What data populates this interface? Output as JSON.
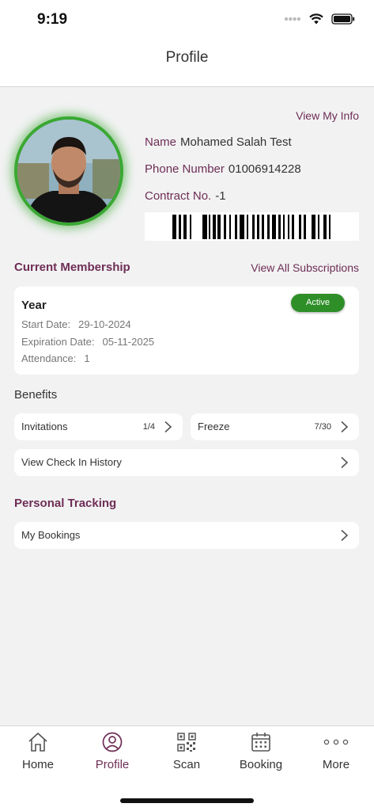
{
  "status_bar": {
    "time": "9:19"
  },
  "header": {
    "title": "Profile"
  },
  "profile": {
    "view_info_link": "View My Info",
    "name_label": "Name",
    "name_value": "Mohamed Salah Test",
    "phone_label": "Phone Number",
    "phone_value": "01006914228",
    "contract_label": "Contract No.",
    "contract_value": "-1"
  },
  "membership": {
    "section_title": "Current Membership",
    "view_all_link": "View All Subscriptions",
    "plan_name": "Year",
    "status": "Active",
    "start_label": "Start Date:",
    "start_value": "29-10-2024",
    "expiration_label": "Expiration Date:",
    "expiration_value": "05-11-2025",
    "attendance_label": "Attendance:",
    "attendance_value": "1"
  },
  "benefits": {
    "title": "Benefits",
    "invitations_label": "Invitations",
    "invitations_count": "1/4",
    "freeze_label": "Freeze",
    "freeze_count": "7/30",
    "history_label": "View Check In History"
  },
  "tracking": {
    "section_title": "Personal Tracking",
    "bookings_label": "My Bookings"
  },
  "tab_bar": {
    "items": [
      {
        "label": "Home",
        "icon": "home-icon"
      },
      {
        "label": "Profile",
        "icon": "user-circle-icon"
      },
      {
        "label": "Scan",
        "icon": "qr-code-icon"
      },
      {
        "label": "Booking",
        "icon": "calendar-icon"
      },
      {
        "label": "More",
        "icon": "more-dots-icon"
      }
    ],
    "active": "Profile"
  },
  "colors": {
    "accent": "#6e2e55",
    "active_badge": "#2e8f28",
    "avatar_ring": "#3aa832",
    "background": "#f2f2f3"
  }
}
